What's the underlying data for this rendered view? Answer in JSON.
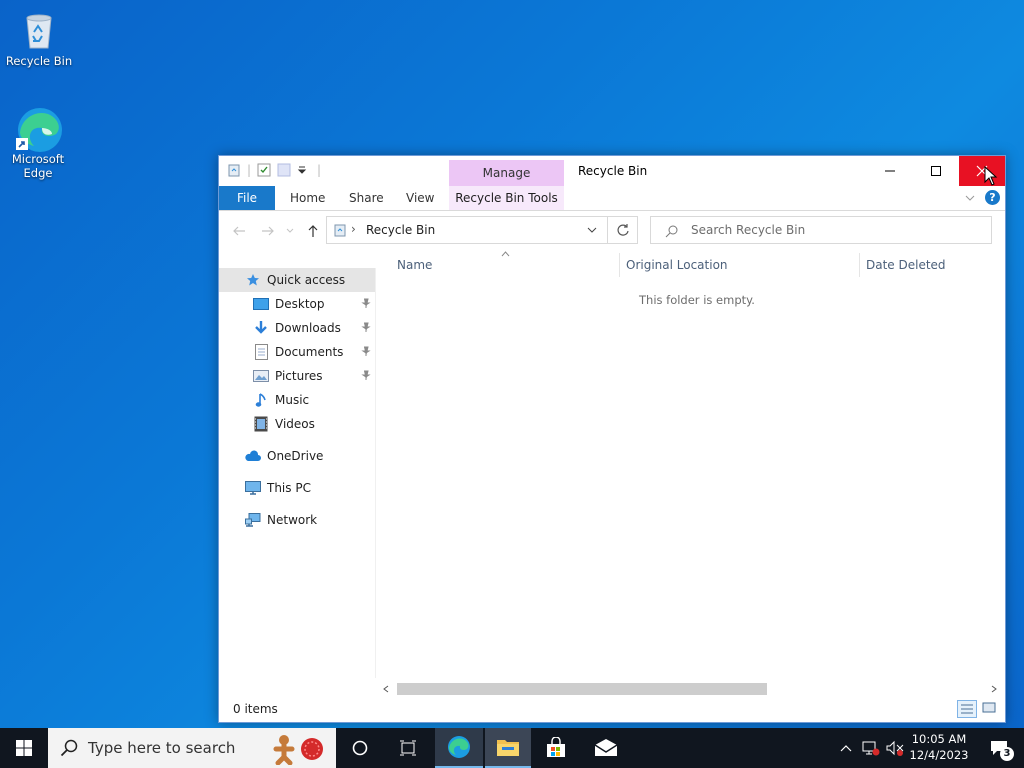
{
  "desktop": {
    "icons": [
      {
        "label": "Recycle Bin"
      },
      {
        "label": "Microsoft\nEdge"
      }
    ]
  },
  "window": {
    "title": "Recycle Bin",
    "manage_tab": "Manage",
    "ribbon": {
      "file": "File",
      "home": "Home",
      "share": "Share",
      "view": "View",
      "recycle_bin_tools": "Recycle Bin Tools"
    },
    "address": {
      "path": "Recycle Bin"
    },
    "search": {
      "placeholder": "Search Recycle Bin"
    },
    "nav": {
      "quick_access": "Quick access",
      "desktop": "Desktop",
      "downloads": "Downloads",
      "documents": "Documents",
      "pictures": "Pictures",
      "music": "Music",
      "videos": "Videos",
      "onedrive": "OneDrive",
      "this_pc": "This PC",
      "network": "Network"
    },
    "columns": {
      "name": "Name",
      "original_location": "Original Location",
      "date_deleted": "Date Deleted"
    },
    "empty_message": "This folder is empty.",
    "status": "0 items"
  },
  "taskbar": {
    "search_placeholder": "Type here to search",
    "time": "10:05 AM",
    "date": "12/4/2023",
    "notification_count": "3"
  },
  "colors": {
    "accent": "#1979ca",
    "close_hover": "#e81123",
    "manage_tab": "#ecc6f5"
  }
}
